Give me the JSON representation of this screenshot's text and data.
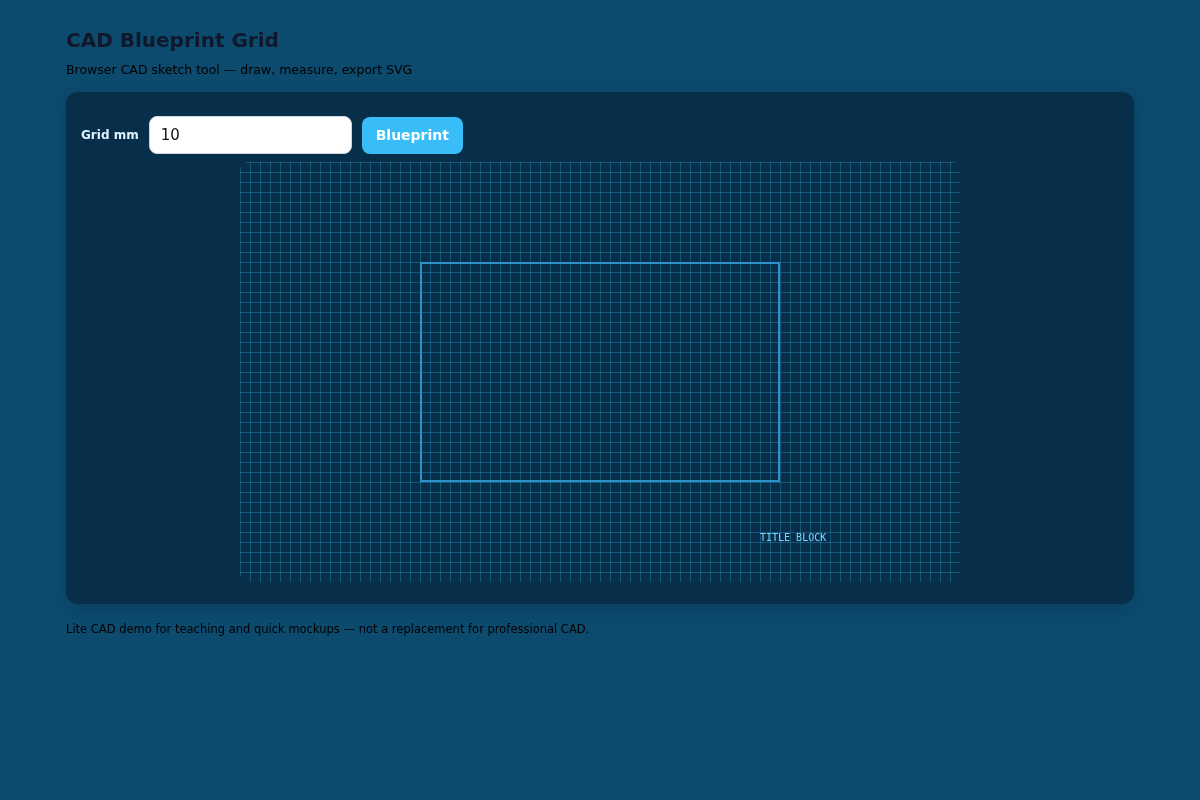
{
  "header": {
    "title": "CAD Blueprint Grid",
    "subtitle": "Browser CAD sketch tool — draw, measure, export SVG"
  },
  "controls": {
    "grid_label": "Grid mm",
    "grid_input": {
      "value": "10"
    },
    "button": "Blueprint"
  },
  "canvas": {
    "label": "TITLE BLOCK"
  },
  "footer": "Lite CAD demo for teaching and quick mockups — not a replacement for professional CAD."
}
